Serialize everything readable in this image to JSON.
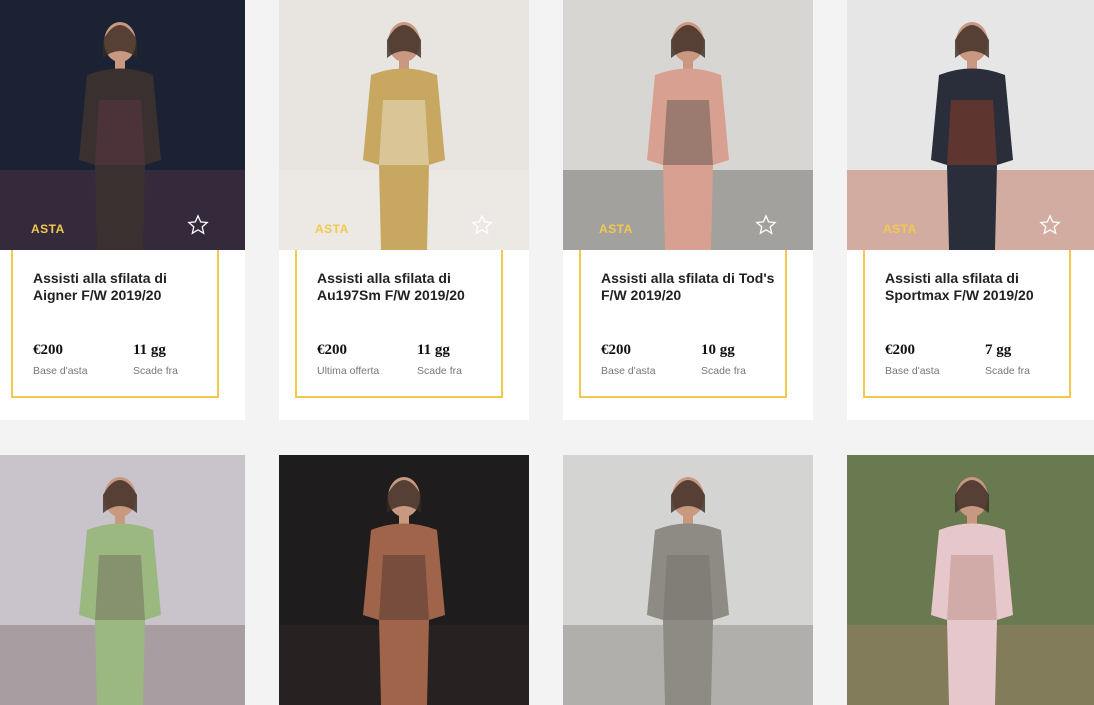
{
  "listings": [
    {
      "badge": "ASTA",
      "title": "Assisti alla sfilata di Aigner F/W 2019/20",
      "price": "€200",
      "price_label": "Base d'asta",
      "days": "11 gg",
      "days_label": "Scade fra",
      "colors": {
        "bg": "#1a2233",
        "figure": "#3a3030",
        "accent": "#6a3a4a"
      }
    },
    {
      "badge": "ASTA",
      "title": "Assisti alla sfilata di Au197Sm F/W 2019/20",
      "price": "€200",
      "price_label": "Ultima offerta",
      "days": "11 gg",
      "days_label": "Scade fra",
      "colors": {
        "bg": "#e8e4e0",
        "figure": "#c8a860",
        "accent": "#f4f0e8"
      }
    },
    {
      "badge": "ASTA",
      "title": "Assisti alla sfilata di Tod's F/W 2019/20",
      "price": "€200",
      "price_label": "Base d'asta",
      "days": "10 gg",
      "days_label": "Scade fra",
      "colors": {
        "bg": "#d8d6d2",
        "figure": "#d8a090",
        "accent": "#404040"
      }
    },
    {
      "badge": "ASTA",
      "title": "Assisti alla sfilata di Sportmax F/W 2019/20",
      "price": "€200",
      "price_label": "Base d'asta",
      "days": "7 gg",
      "days_label": "Scade fra",
      "colors": {
        "bg": "#e6e6e6",
        "figure": "#2a2e3a",
        "accent": "#b04020"
      }
    }
  ],
  "gallery": [
    {
      "colors": {
        "bg": "#c9c4cc",
        "figure": "#9ab880",
        "accent": "#6a5a50"
      }
    },
    {
      "colors": {
        "bg": "#1e1c1c",
        "figure": "#a0644a",
        "accent": "#3a2a2a"
      }
    },
    {
      "colors": {
        "bg": "#d4d4d2",
        "figure": "#8e8a84",
        "accent": "#6e6a64"
      }
    },
    {
      "colors": {
        "bg": "#6a7a50",
        "figure": "#e6c8cc",
        "accent": "#b08070"
      }
    }
  ]
}
